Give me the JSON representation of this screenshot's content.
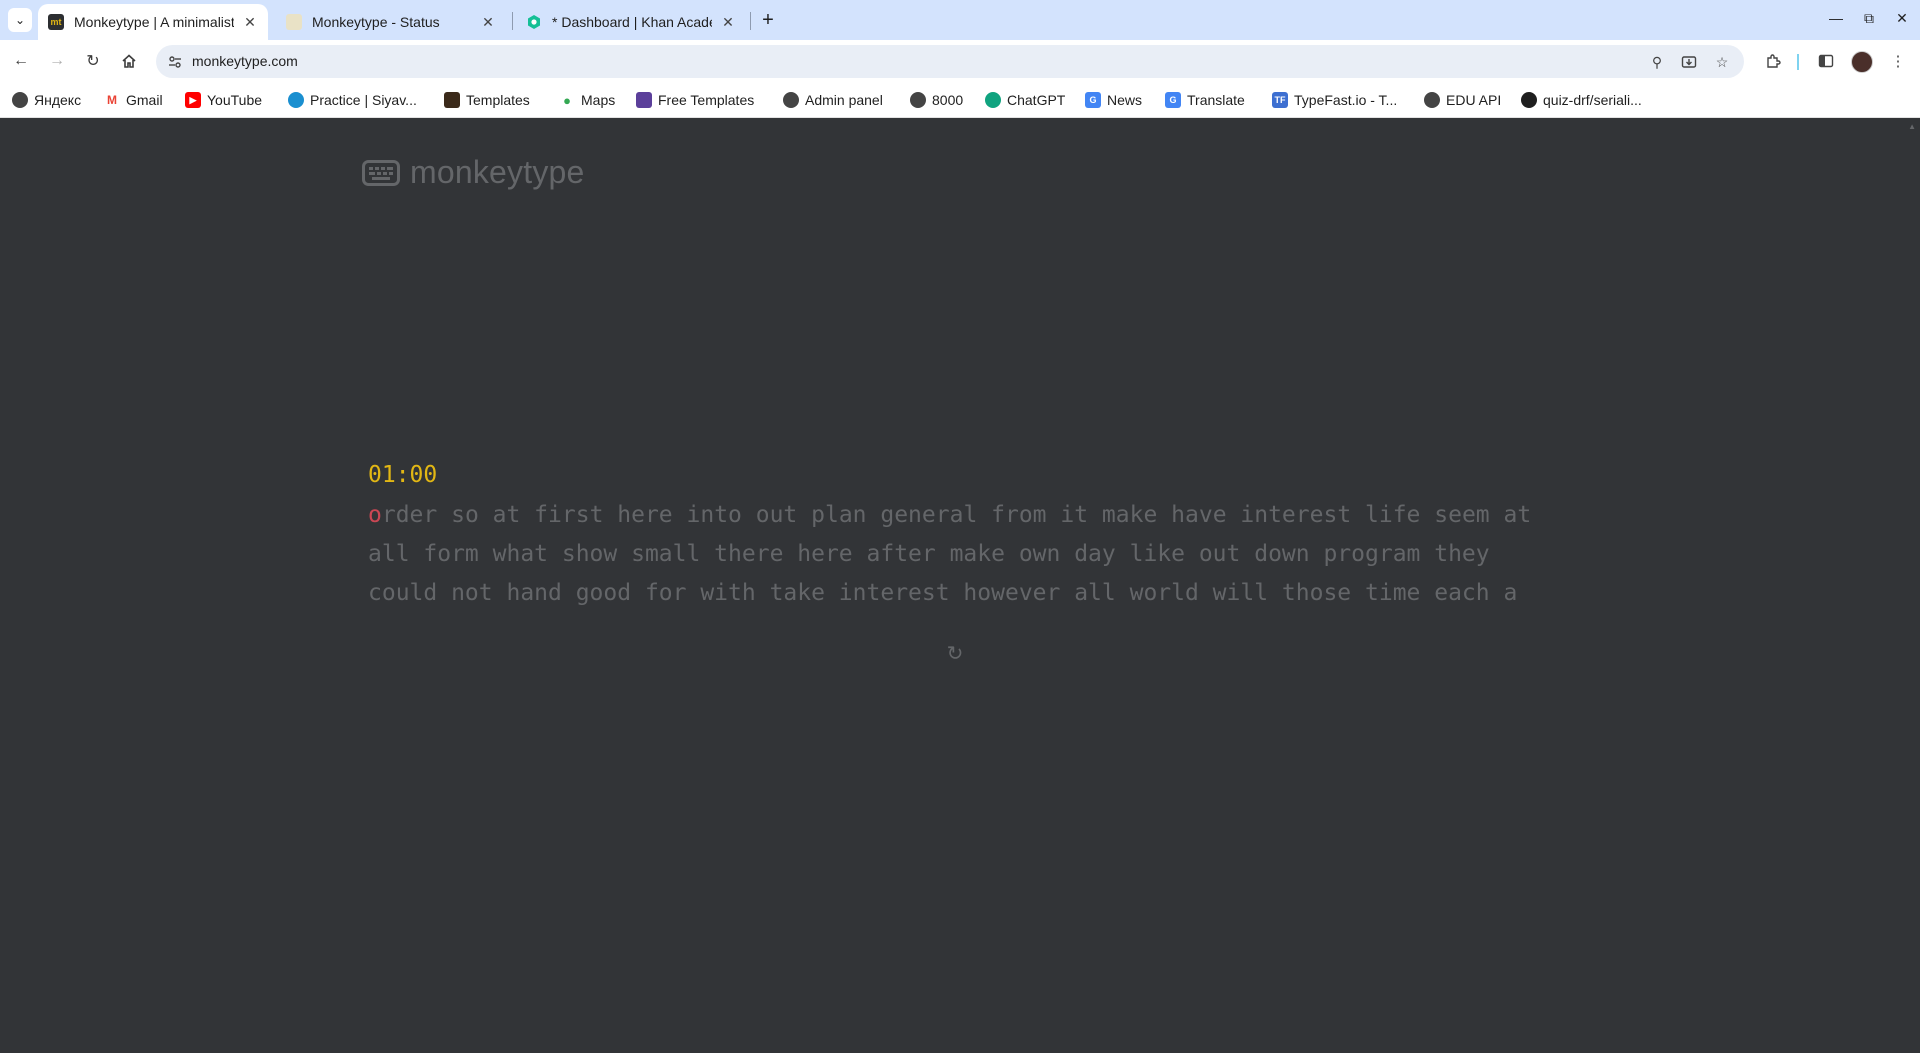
{
  "browser": {
    "tabs": [
      {
        "title": "Monkeytype | A minimalistic",
        "favicon": "mt",
        "favicon_color": "#2c2e31",
        "active": true
      },
      {
        "title": "Monkeytype - Status",
        "favicon": "",
        "favicon_color": "#e9e2c6",
        "active": false
      },
      {
        "title": "* Dashboard | Khan Academy",
        "favicon": "ka",
        "favicon_color": "#14bf96",
        "active": false
      }
    ],
    "url": "monkeytype.com",
    "bookmarks": [
      {
        "label": "Яндекс",
        "icon": "globe-icon",
        "color": "#444444"
      },
      {
        "label": "Gmail",
        "icon": "gmail-icon",
        "color": "#ea4335"
      },
      {
        "label": "YouTube",
        "icon": "youtube-icon",
        "color": "#ff0000"
      },
      {
        "label": "Practice | Siyav...",
        "icon": "siyavula-icon",
        "color": "#1a8fd0"
      },
      {
        "label": "Templates",
        "icon": "templates-icon",
        "color": "#3b2a1a"
      },
      {
        "label": "Maps",
        "icon": "maps-icon",
        "color": "#34a853"
      },
      {
        "label": "Free Templates",
        "icon": "free-templates-icon",
        "color": "#5b3f9a"
      },
      {
        "label": "Admin panel",
        "icon": "globe-icon",
        "color": "#444444"
      },
      {
        "label": "8000",
        "icon": "globe-icon",
        "color": "#444444"
      },
      {
        "label": "ChatGPT",
        "icon": "chatgpt-icon",
        "color": "#10a37f"
      },
      {
        "label": "News",
        "icon": "news-icon",
        "color": "#4285f4"
      },
      {
        "label": "Translate",
        "icon": "translate-icon",
        "color": "#4285f4"
      },
      {
        "label": "TypeFast.io - T...",
        "icon": "typefast-icon",
        "color": "#3d6fd1"
      },
      {
        "label": "EDU API",
        "icon": "globe-icon",
        "color": "#444444"
      },
      {
        "label": "quiz-drf/seriali...",
        "icon": "github-icon",
        "color": "#1f1f1f"
      }
    ]
  },
  "app": {
    "logo_text": "monkeytype",
    "timer": "01:00",
    "current_letter": "o",
    "words_lines": [
      "rder so at first here into out plan general from it make have interest life seem at",
      "all form what show small there here after make own day like out down program they",
      "could not hand good for with take interest however all world will those time each a"
    ],
    "colors": {
      "background": "#323437",
      "main": "#e2b714",
      "sub": "#646669",
      "error": "#ca4754"
    }
  }
}
